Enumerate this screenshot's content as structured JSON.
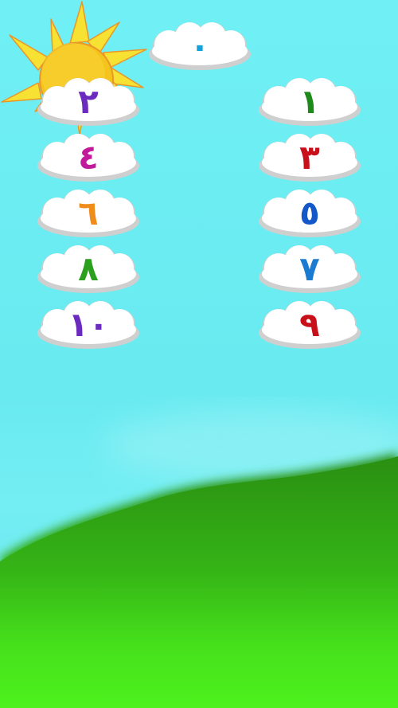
{
  "numbers": [
    {
      "digit": "٠",
      "color": "#14a3d8"
    },
    {
      "digit": "١",
      "color": "#1e8a1a"
    },
    {
      "digit": "٢",
      "color": "#6b2bbf"
    },
    {
      "digit": "٣",
      "color": "#c8101a"
    },
    {
      "digit": "٤",
      "color": "#c11b9b"
    },
    {
      "digit": "٥",
      "color": "#1457c8"
    },
    {
      "digit": "٦",
      "color": "#f08c1a"
    },
    {
      "digit": "٧",
      "color": "#1a7bd0"
    },
    {
      "digit": "٨",
      "color": "#2aa01e"
    },
    {
      "digit": "٩",
      "color": "#c8101a"
    },
    {
      "digit": "١٠",
      "color": "#6b2bbf"
    }
  ],
  "colors": {
    "sky": "#6eeef3",
    "hill_dark": "#2a8f12",
    "hill_light": "#4cf01c",
    "sun": "#f7e233",
    "sun_outline": "#e9962a",
    "cloud_fill": "#ffffff",
    "cloud_shadow": "#d9d9d9"
  }
}
